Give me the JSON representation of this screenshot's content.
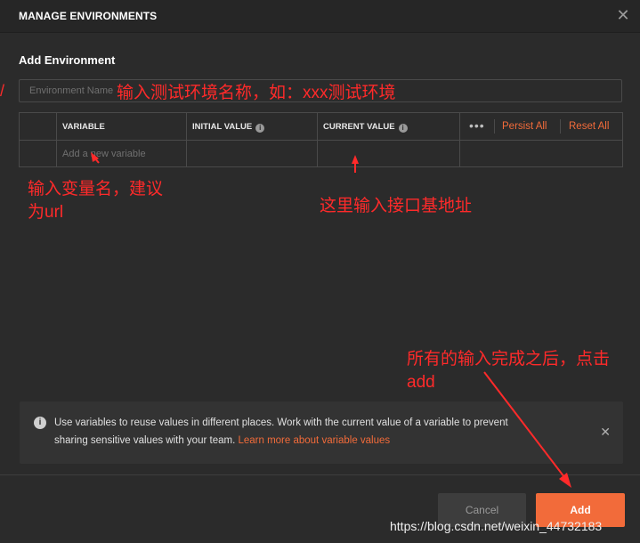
{
  "header": {
    "title": "MANAGE ENVIRONMENTS"
  },
  "section_title": "Add Environment",
  "env_input": {
    "placeholder": "Environment Name"
  },
  "table": {
    "headers": {
      "variable": "VARIABLE",
      "initial_value": "INITIAL VALUE",
      "current_value": "CURRENT VALUE"
    },
    "actions": {
      "more": "•••",
      "persist_all": "Persist All",
      "reset_all": "Reset All"
    },
    "row_placeholder": "Add a new variable"
  },
  "info": {
    "line1": "Use variables to reuse values in different places. Work with the current value of a variable to prevent",
    "line2": "sharing sensitive values with your team.",
    "link": "Learn more about variable values"
  },
  "buttons": {
    "cancel": "Cancel",
    "add": "Add"
  },
  "annotations": {
    "env_name": "输入测试环境名称，如：xxx测试环境",
    "var_name_line1": "输入变量名，建议",
    "var_name_line2": "为url",
    "current_value": "这里输入接口基地址",
    "add_line1": "所有的输入完成之后，点击",
    "add_line2": "add"
  },
  "watermark": "https://blog.csdn.net/weixin_44732183",
  "colors": {
    "accent": "#f26b3a",
    "annotation": "#ff2a2a",
    "background": "#2b2b2b"
  }
}
